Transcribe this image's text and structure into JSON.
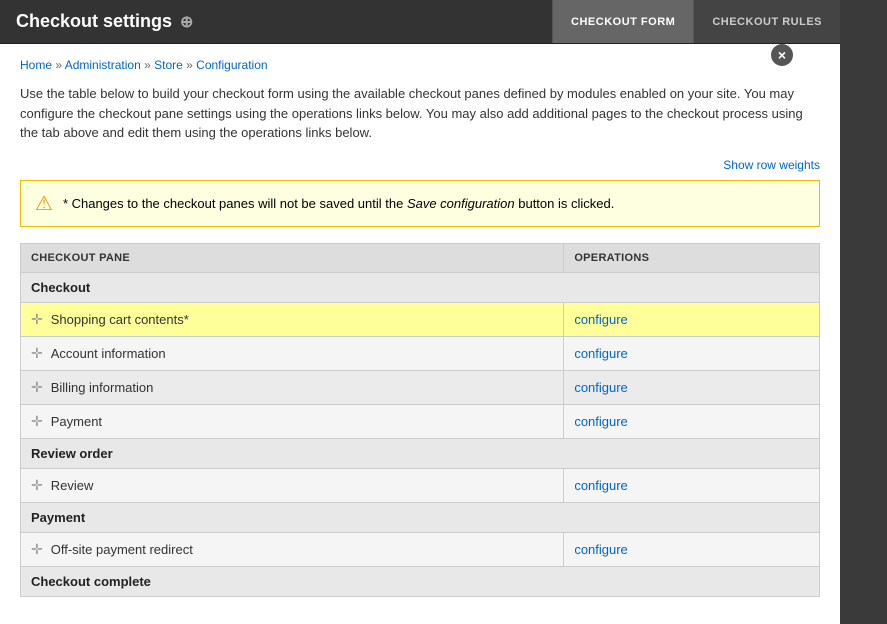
{
  "header": {
    "title": "Checkout settings",
    "plus_icon": "⊕",
    "tabs": [
      {
        "id": "checkout-form",
        "label": "CHECKOUT FORM",
        "active": true
      },
      {
        "id": "checkout-rules",
        "label": "CHECKOUT RULES",
        "active": false
      }
    ]
  },
  "close_button": "×",
  "breadcrumb": {
    "links": [
      {
        "label": "Home",
        "href": "#"
      },
      {
        "label": "Administration",
        "href": "#"
      },
      {
        "label": "Store",
        "href": "#"
      },
      {
        "label": "Configuration",
        "href": "#"
      }
    ],
    "separator": " » "
  },
  "description": "Use the table below to build your checkout form using the available checkout panes defined by modules enabled on your site. You may configure the checkout pane settings using the operations links below. You may also add additional pages to the checkout process using the tab above and edit them using the operations links below.",
  "show_row_weights": "Show row weights",
  "warning": {
    "icon": "⚠",
    "text_before": "* Changes to the checkout panes will not be saved until the ",
    "text_em": "Save configuration",
    "text_after": " button is clicked."
  },
  "table": {
    "columns": [
      {
        "id": "pane",
        "label": "CHECKOUT PANE"
      },
      {
        "id": "ops",
        "label": "OPERATIONS"
      }
    ],
    "sections": [
      {
        "title": "Checkout",
        "rows": [
          {
            "id": "shopping-cart",
            "name": "Shopping cart contents*",
            "configure": "configure",
            "highlight": true
          },
          {
            "id": "account-info",
            "name": "Account information",
            "configure": "configure",
            "highlight": false
          },
          {
            "id": "billing-info",
            "name": "Billing information",
            "configure": "configure",
            "highlight": false
          },
          {
            "id": "payment",
            "name": "Payment",
            "configure": "configure",
            "highlight": false
          }
        ]
      },
      {
        "title": "Review order",
        "rows": [
          {
            "id": "review",
            "name": "Review",
            "configure": "configure",
            "highlight": false
          }
        ]
      },
      {
        "title": "Payment",
        "rows": [
          {
            "id": "offsite-payment",
            "name": "Off-site payment redirect",
            "configure": "configure",
            "highlight": false
          }
        ]
      },
      {
        "title": "Checkout complete",
        "rows": []
      }
    ]
  }
}
